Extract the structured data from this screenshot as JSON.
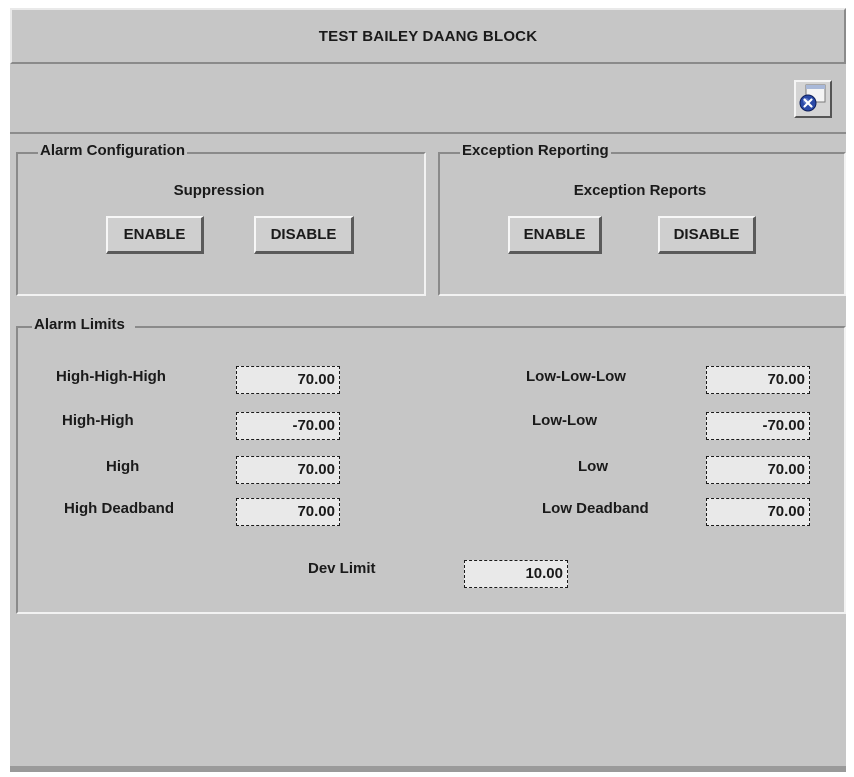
{
  "window": {
    "title": "TEST BAILEY DAANG BLOCK",
    "close_icon": "close-icon"
  },
  "alarm_config": {
    "legend": "Alarm Configuration",
    "subtitle": "Suppression",
    "enable_label": "ENABLE",
    "disable_label": "DISABLE"
  },
  "exception_reporting": {
    "legend": "Exception Reporting",
    "subtitle": "Exception Reports",
    "enable_label": "ENABLE",
    "disable_label": "DISABLE"
  },
  "alarm_limits": {
    "legend": "Alarm Limits",
    "left": [
      {
        "label": "High-High-High",
        "value": "70.00"
      },
      {
        "label": "High-High",
        "value": "-70.00"
      },
      {
        "label": "High",
        "value": "70.00"
      },
      {
        "label": "High Deadband",
        "value": "70.00"
      }
    ],
    "right": [
      {
        "label": "Low-Low-Low",
        "value": "70.00"
      },
      {
        "label": "Low-Low",
        "value": "-70.00"
      },
      {
        "label": "Low",
        "value": "70.00"
      },
      {
        "label": "Low Deadband",
        "value": "70.00"
      }
    ],
    "dev_limit": {
      "label": "Dev Limit",
      "value": "10.00"
    }
  },
  "colors": {
    "panel": "#c6c6c6",
    "field": "#e9e9e9",
    "close_badge": "#2a4aa8"
  }
}
